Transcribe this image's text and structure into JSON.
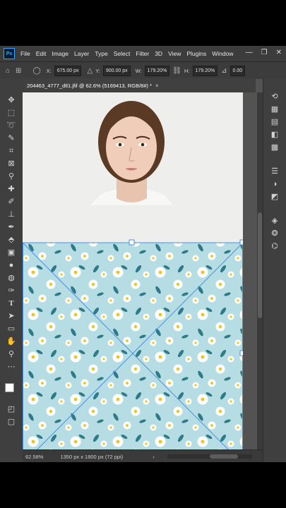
{
  "app": {
    "logo": "Ps",
    "menu": [
      "File",
      "Edit",
      "Image",
      "Layer",
      "Type",
      "Select",
      "Filter",
      "3D",
      "View",
      "Plugins",
      "Window"
    ],
    "window_controls": [
      "—",
      "❐",
      "✕"
    ]
  },
  "options_bar": {
    "x_label": "X:",
    "x_value": "675.00 px",
    "y_label": "Y:",
    "y_value": "900.00 px",
    "w_label": "W:",
    "w_value": "179.20%",
    "h_label": "H:",
    "h_value": "179.20%",
    "rotate_value": "0.00"
  },
  "document": {
    "tab_title": "204463_4777_dtl1.jfif @ 62.6% (5169413, RGB/8#) *",
    "close_glyph": "×"
  },
  "status_bar": {
    "zoom": "62.58%",
    "doc_info": "1350 px x 1800 px (72 ppi)",
    "nav_glyph": "›"
  },
  "tools": [
    "move-icon",
    "marquee-icon",
    "lasso-icon",
    "quick-select-icon",
    "crop-icon",
    "frame-icon",
    "eyedropper-icon",
    "healing-icon",
    "brush-icon",
    "clone-stamp-icon",
    "history-brush-icon",
    "eraser-icon",
    "gradient-icon",
    "blur-icon",
    "dodge-icon",
    "pen-icon",
    "type-icon",
    "path-select-icon",
    "rectangle-icon",
    "hand-icon",
    "zoom-icon",
    "edit-toolbar-icon"
  ],
  "right_panel_icons": [
    "history-icon",
    "libraries-icon",
    "properties-icon",
    "color-icon",
    "swatches-icon",
    "adjustments-icon",
    "masks-icon",
    "styles-icon",
    "layers-icon",
    "channels-icon",
    "paths-icon"
  ],
  "colors": {
    "pattern_bg": "#b6dde3",
    "daisy_petal": "#ffffff",
    "daisy_center": "#f2c21b",
    "leaf": "#2e7a86",
    "selection": "#4a90e2"
  }
}
